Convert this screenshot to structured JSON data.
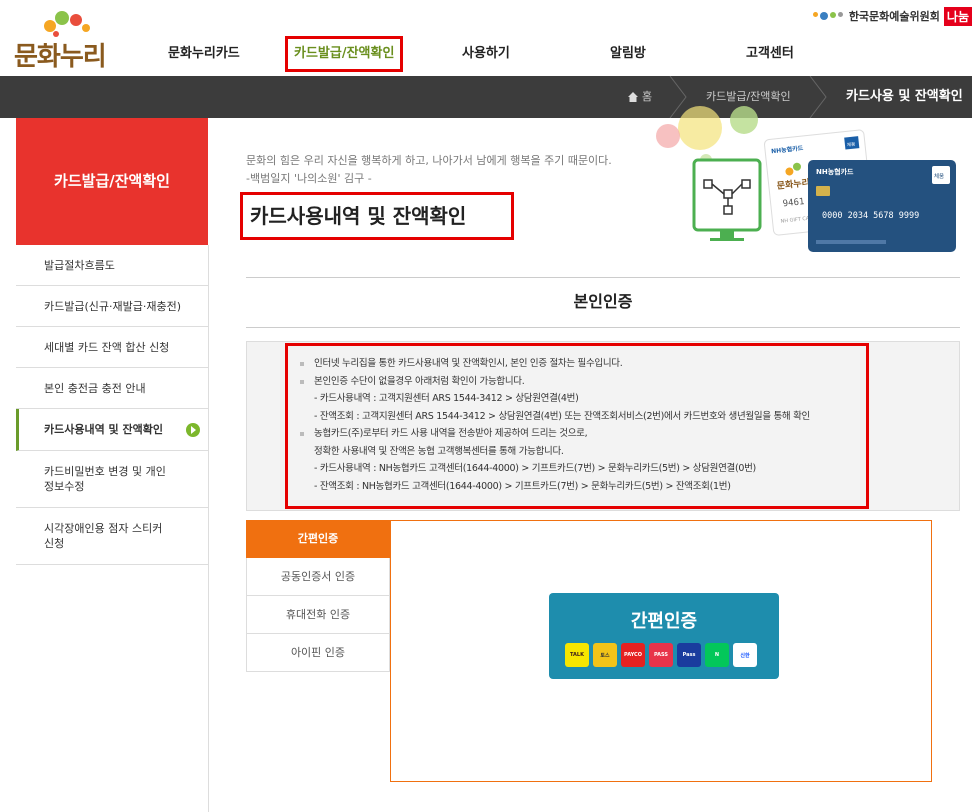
{
  "header": {
    "logo_text": "문화누리",
    "org_name": "한국문화예술위원회",
    "org_badge": "나눔",
    "nav": [
      {
        "label": "문화누리카드"
      },
      {
        "label": "카드발급/잔액확인"
      },
      {
        "label": "사용하기"
      },
      {
        "label": "알림방"
      },
      {
        "label": "고객센터"
      }
    ]
  },
  "breadcrumb": {
    "home": "홈",
    "level1": "카드발급/잔액확인",
    "current": "카드사용 및 잔액확인"
  },
  "sidebar": {
    "title": "카드발급/잔액확인",
    "items": [
      {
        "label": "발급절차흐름도"
      },
      {
        "label": "카드발급(신규·재발급·재충전)"
      },
      {
        "label": "세대별 카드 잔액 합산 신청"
      },
      {
        "label": "본인 충전금 충전 안내"
      },
      {
        "label": "카드사용내역 및 잔액확인"
      },
      {
        "label": "카드비밀번호 변경 및 개인",
        "label2": "정보수정"
      },
      {
        "label": "시각장애인용 점자 스티커",
        "label2": "신청"
      }
    ]
  },
  "main": {
    "quote_line1": "문화의 힘은 우리 자신을 행복하게 하고, 나아가서 남에게 행복을 주기 때문이다.",
    "quote_line2": "-백범일지 '나의소원' 김구 -",
    "page_title": "카드사용내역 및 잔액확인",
    "section_title": "본인인증",
    "hero": {
      "card1_brand": "NH농협카드",
      "card1_logo": "문화누리",
      "card1_number": "9461",
      "card1_sub": "NH GIFT CARD",
      "card2_brand": "NH농협카드",
      "card2_number": "0000 2034 5678 9999",
      "card2_badge": "체움",
      "card1_badge": "체움"
    },
    "info": [
      {
        "type": "bullet",
        "text": "인터넷 누리집을 통한 카드사용내역 및 잔액확인시, 본인 인증 절차는 필수입니다."
      },
      {
        "type": "bullet",
        "text": "본인인증 수단이 없을경우 아래처럼 확인이 가능합니다."
      },
      {
        "type": "sub",
        "text": "- 카드사용내역 : 고객지원센터 ARS 1544-3412 > 상담원연결(4번)"
      },
      {
        "type": "sub",
        "text": "- 잔액조회 : 고객지원센터 ARS 1544-3412 > 상담원연결(4번) 또는 잔액조회서비스(2번)에서 카드번호와 생년월일을 통해 확인"
      },
      {
        "type": "bullet",
        "text": "농협카드(주)로부터 카드 사용 내역을 전송받아 제공하여 드리는 것으로,"
      },
      {
        "type": "sub",
        "text": "정확한 사용내역 및 잔액은 농협 고객행복센터를 통해 가능합니다."
      },
      {
        "type": "sub",
        "text": "- 카드사용내역 : NH농협카드 고객센터(1644-4000) > 기프트카드(7번) > 문화누리카드(5번) > 상담원연결(0번)"
      },
      {
        "type": "sub",
        "text": "- 잔액조회 : NH농협카드 고객센터(1644-4000) > 기프트카드(7번) > 문화누리카드(5번) > 잔액조회(1번)"
      }
    ],
    "tabs": [
      {
        "label": "간편인증"
      },
      {
        "label": "공동인증서 인증"
      },
      {
        "label": "휴대전화 인증"
      },
      {
        "label": "아이핀 인증"
      }
    ],
    "simple_auth": {
      "label": "간편인증",
      "providers": [
        {
          "name": "TALK",
          "color": "#f7e600",
          "text_color": "#3a1d1d"
        },
        {
          "name": "토스",
          "color": "#f2c318",
          "text_color": "#333"
        },
        {
          "name": "PAYCO",
          "color": "#e52121",
          "text_color": "#ffffff"
        },
        {
          "name": "PASS",
          "color": "#e8334a",
          "text_color": "#ffffff"
        },
        {
          "name": "Pass",
          "color": "#1a3c9e",
          "text_color": "#ffffff"
        },
        {
          "name": "N",
          "color": "#03c75a",
          "text_color": "#ffffff"
        },
        {
          "name": "신한",
          "color": "#ffffff",
          "text_color": "#0046ff"
        }
      ]
    }
  },
  "colors": {
    "accent_red": "#e8332d",
    "highlight_border": "#e50000",
    "tab_orange": "#f07010",
    "auth_blue": "#1e8dad",
    "nav_active": "#6a8f1e"
  }
}
